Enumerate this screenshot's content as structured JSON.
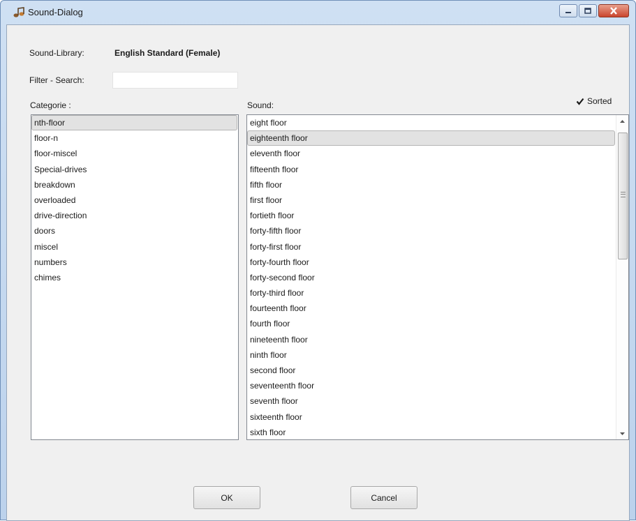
{
  "window": {
    "title": "Sound-Dialog",
    "icon": "music-note-icon",
    "controls": {
      "minimize": "minimize-icon",
      "maximize": "maximize-icon",
      "close": "close-icon"
    },
    "close_color": "#c9452e"
  },
  "library": {
    "label": "Sound-Library:",
    "value": "English Standard (Female)"
  },
  "filter": {
    "label": "Filter - Search:",
    "value": "",
    "placeholder": ""
  },
  "category": {
    "label": "Categorie :",
    "selected": "nth-floor",
    "items": [
      "nth-floor",
      "floor-n",
      "floor-miscel",
      "Special-drives",
      "breakdown",
      "overloaded",
      "drive-direction",
      "doors",
      "miscel",
      "numbers",
      "chimes"
    ]
  },
  "sound": {
    "label": "Sound:",
    "selected": "eighteenth floor",
    "items": [
      "eight floor",
      "eighteenth floor",
      "eleventh floor",
      "fifteenth floor",
      "fifth floor",
      "first floor",
      "fortieth floor",
      "forty-fifth floor",
      "forty-first floor",
      "forty-fourth floor",
      "forty-second floor",
      "forty-third floor",
      "fourteenth floor",
      "fourth floor",
      "nineteenth floor",
      "ninth floor",
      "second floor",
      "seventeenth floor",
      "seventh floor",
      "sixteenth floor",
      "sixth floor"
    ]
  },
  "sorted": {
    "label": "Sorted",
    "checked": true
  },
  "buttons": {
    "ok": "OK",
    "cancel": "Cancel"
  }
}
